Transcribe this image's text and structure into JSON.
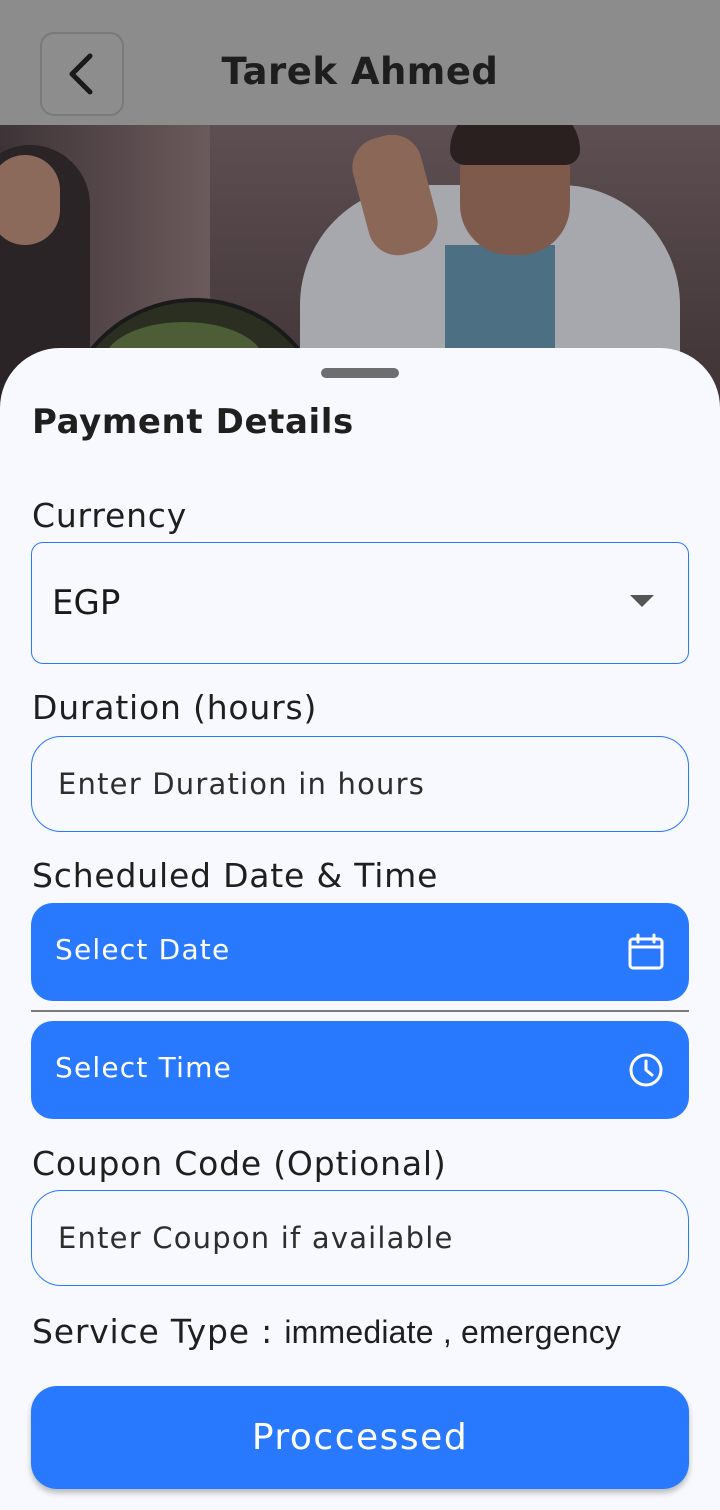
{
  "header": {
    "title": "Tarek Ahmed"
  },
  "sheet": {
    "title": "Payment Details",
    "currency": {
      "label": "Currency",
      "value": "EGP"
    },
    "duration": {
      "label": "Duration (hours)",
      "placeholder": "Enter Duration in hours"
    },
    "schedule": {
      "label": "Scheduled Date & Time",
      "date_button": "Select Date",
      "time_button": "Select Time"
    },
    "coupon": {
      "label": "Coupon Code (Optional)",
      "placeholder": "Enter Coupon if available"
    },
    "service_type": {
      "label": "Service Type :",
      "value": "immediate , emergency"
    },
    "submit_label": "Proccessed"
  },
  "colors": {
    "accent": "#2979ff",
    "sheet_bg": "#f8f9fe",
    "scrim": "#8c8c8d"
  },
  "icons": [
    "back-arrow-icon",
    "dropdown-caret-icon",
    "calendar-icon",
    "clock-icon"
  ]
}
